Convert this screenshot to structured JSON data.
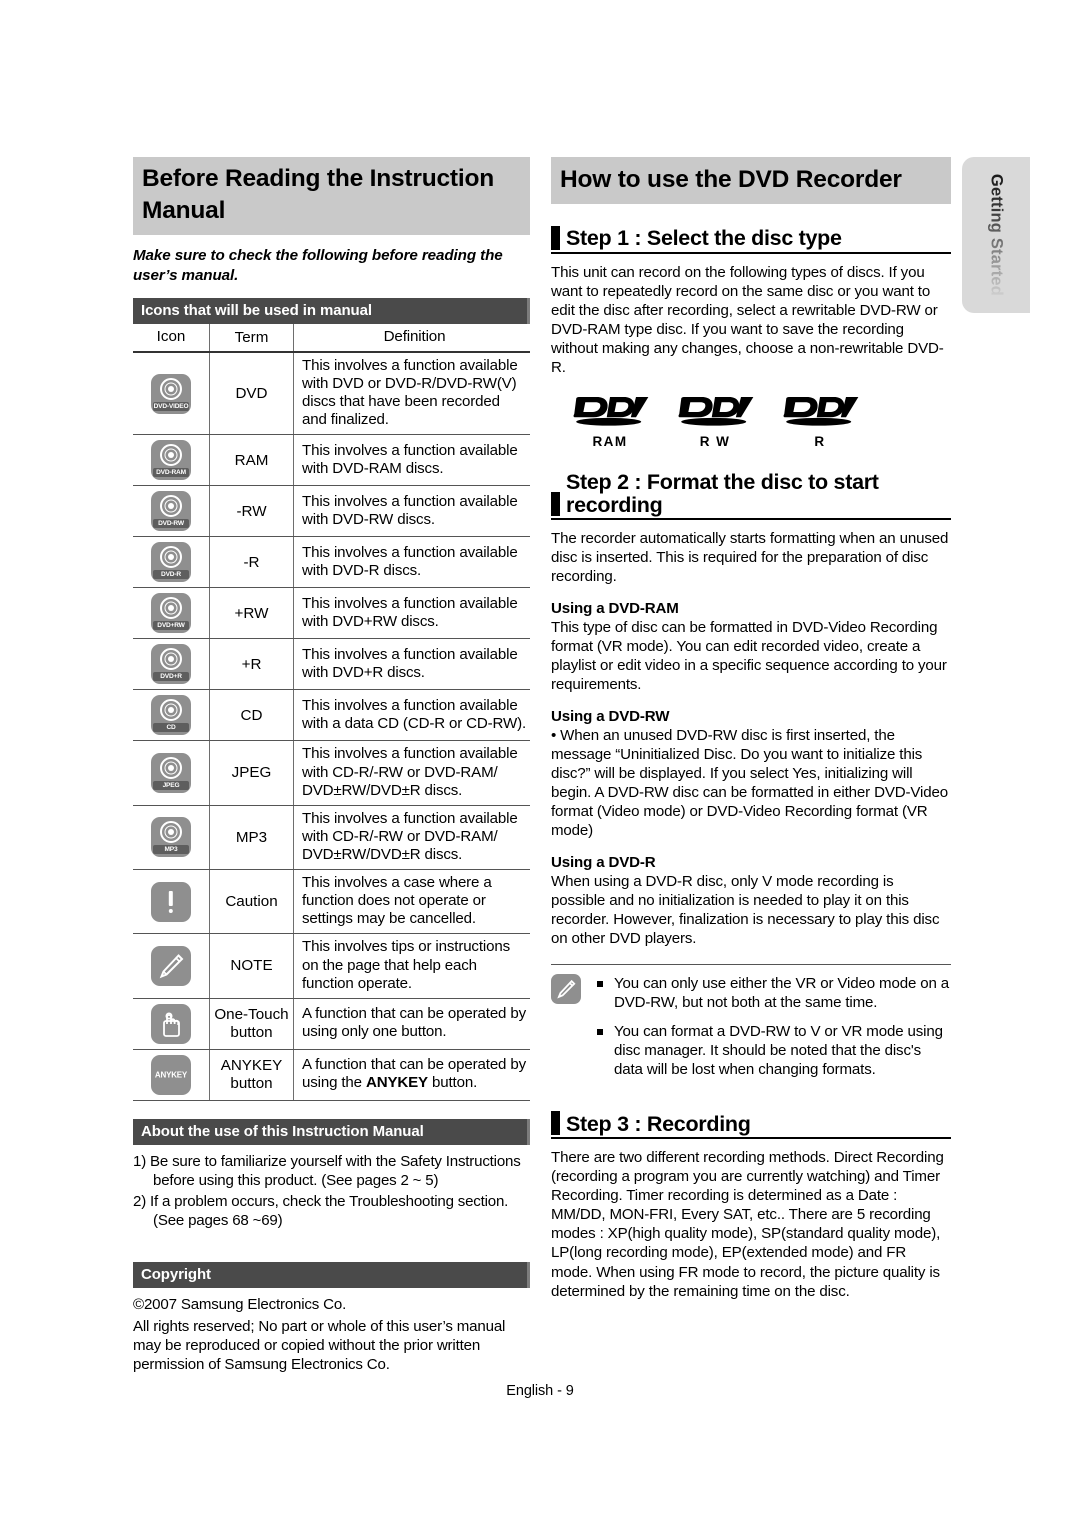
{
  "left": {
    "banner_title": "Before Reading the Instruction Manual",
    "intro": "Make sure to check the following before reading the user’s manual.",
    "icons_section_title": "Icons that will be used in manual",
    "table": {
      "headers": [
        "Icon",
        "Term",
        "Definition"
      ],
      "rows": [
        {
          "icon": "dvd-video-disc-icon",
          "icon_label": "DVD-VIDEO",
          "term": "DVD",
          "definition": "This involves a function available with DVD or DVD-R/DVD-RW(V) discs that have been recorded and finalized."
        },
        {
          "icon": "dvd-ram-disc-icon",
          "icon_label": "DVD-RAM",
          "term": "RAM",
          "definition": "This involves a function available with DVD-RAM discs."
        },
        {
          "icon": "dvd-rw-disc-icon",
          "icon_label": "DVD-RW",
          "term": "-RW",
          "definition": "This involves a function available with DVD-RW discs."
        },
        {
          "icon": "dvd-r-disc-icon",
          "icon_label": "DVD-R",
          "term": "-R",
          "definition": "This involves a function available with DVD-R discs."
        },
        {
          "icon": "dvd-plus-rw-disc-icon",
          "icon_label": "DVD+RW",
          "term": "+RW",
          "definition": "This involves a function available with DVD+RW discs."
        },
        {
          "icon": "dvd-plus-r-disc-icon",
          "icon_label": "DVD+R",
          "term": "+R",
          "definition": "This involves a function available with DVD+R discs."
        },
        {
          "icon": "cd-disc-icon",
          "icon_label": "CD",
          "term": "CD",
          "definition": "This involves a function available with a data CD (CD-R or CD-RW)."
        },
        {
          "icon": "jpeg-disc-icon",
          "icon_label": "JPEG",
          "term": "JPEG",
          "definition": "This involves a function available with CD-R/-RW or DVD-RAM/ DVD±RW/DVD±R discs."
        },
        {
          "icon": "mp3-disc-icon",
          "icon_label": "MP3",
          "term": "MP3",
          "definition": "This involves a function available with CD-R/-RW or DVD-RAM/ DVD±RW/DVD±R discs."
        },
        {
          "icon": "caution-exclamation-icon",
          "icon_label": "",
          "term": "Caution",
          "definition": "This involves a case where a function does not operate or settings may be cancelled."
        },
        {
          "icon": "note-pencil-icon",
          "icon_label": "",
          "term": "NOTE",
          "definition": "This involves tips or instructions on the page that help each function operate."
        },
        {
          "icon": "one-touch-hand-icon",
          "icon_label": "",
          "term": "One-Touch button",
          "definition": "A function that can be operated by using only one button."
        },
        {
          "icon": "anykey-button-icon",
          "icon_label": "ANYKEY",
          "term": "ANYKEY button",
          "definition": "A function that can be operated by using the ANYKEY button."
        }
      ]
    },
    "about_section_title": "About the use of this Instruction Manual",
    "about_items": [
      "1) Be sure to familiarize yourself with the Safety Instructions before using this product. (See pages 2 ~ 5)",
      "2) If a problem occurs, check the Troubleshooting section. (See pages 68 ~69)"
    ],
    "copyright_section_title": "Copyright",
    "copyright_line1": "©2007 Samsung Electronics Co.",
    "copyright_line2": "All rights reserved; No part or whole of this user’s manual may be reproduced or copied without the prior written permission of Samsung Electronics Co."
  },
  "right": {
    "banner_title": "How to use the DVD Recorder",
    "step1": {
      "title": "Step 1 : Select the disc type",
      "body": "This unit can record on the following types of discs. If you want to repeatedly record on the same disc or you want to edit the disc after recording, select a rewritable DVD-RW or DVD-RAM type disc. If you want to save the recording without making any changes, choose a non-rewritable DVD-R.",
      "logos": [
        {
          "name": "dvd-logo",
          "caption": "RAM"
        },
        {
          "name": "dvd-logo",
          "caption": "R W"
        },
        {
          "name": "dvd-logo",
          "caption": "R"
        }
      ]
    },
    "step2": {
      "title": "Step 2 : Format the disc to start recording",
      "body": "The recorder automatically starts formatting when an unused disc is inserted. This is required for the preparation of disc recording.",
      "ram_heading": "Using a DVD-RAM",
      "ram_body": "This type of disc can be formatted in DVD-Video Recording format (VR mode). You can edit recorded video, create a playlist or edit video in a specific sequence according to your requirements.",
      "rw_heading": "Using a DVD-RW",
      "rw_body": "• When an unused DVD-RW disc is first inserted, the message “Uninitialized Disc. Do you want to initialize this disc?” will be displayed. If you select Yes, initializing will begin. A DVD-RW disc can be formatted in either DVD-Video format (Video mode) or DVD-Video Recording format (VR mode)",
      "r_heading": "Using a DVD-R",
      "r_body": "When using a DVD-R disc, only V mode recording is possible and no initialization is needed to play it on this recorder. However, finalization is necessary to play this disc on other DVD players.",
      "note_icon": "note-pencil-icon",
      "notes": [
        "You can only use either the VR or Video mode on a DVD-RW, but not both at the same time.",
        "You can format a DVD-RW to V or VR mode using disc manager. It should be noted that the disc's data will be lost when changing formats."
      ]
    },
    "step3": {
      "title": "Step 3 : Recording",
      "body": "There are two different recording methods. Direct Recording (recording a program you are currently watching) and Timer Recording. Timer recording is determined as a Date : MM/DD, MON-FRI, Every SAT, etc.. There are 5 recording modes : XP(high quality mode), SP(standard quality mode), LP(long recording mode), EP(extended mode) and FR mode. When using FR mode to record, the picture quality is determined by the remaining time on the disc."
    }
  },
  "side_tab": {
    "label": "Getting Started"
  },
  "footer": {
    "page_label": "English - 9"
  }
}
